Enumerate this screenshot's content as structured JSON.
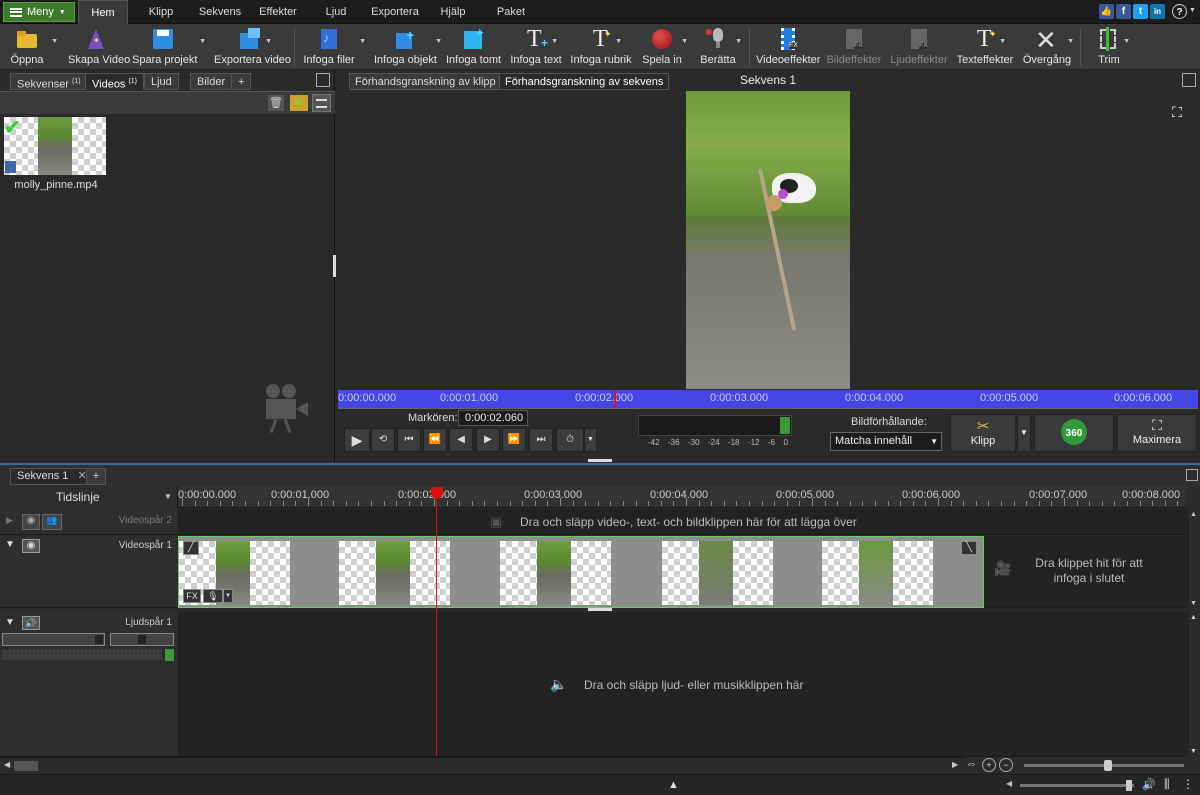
{
  "menubar": {
    "menu_label": "Meny",
    "tabs": [
      "Hem",
      "Klipp",
      "Sekvens",
      "Effekter",
      "Ljud",
      "Exportera",
      "Hjälp",
      "Paket"
    ],
    "social": [
      "f",
      "t",
      "in",
      "?"
    ]
  },
  "toolbar": {
    "open": "Öppna",
    "make_video": "Skapa Video",
    "save_project": "Spara projekt",
    "export_video": "Exportera video",
    "insert_files": "Infoga filer",
    "insert_object": "Infoga objekt",
    "insert_blank": "Infoga tomt",
    "insert_text": "Infoga text",
    "insert_title": "Infoga rubrik",
    "record": "Spela in",
    "narrate": "Berätta",
    "video_effects": "Videoeffekter",
    "image_effects": "Bildeffekter",
    "audio_effects": "Ljudeffekter",
    "text_effects": "Texteffekter",
    "transition": "Övergång",
    "trim": "Trim"
  },
  "leftpanel": {
    "tabs": [
      {
        "label": "Sekvenser",
        "count": "(1)"
      },
      {
        "label": "Videos",
        "count": "(1)"
      },
      {
        "label": "Ljud",
        "count": ""
      },
      {
        "label": "Bilder",
        "count": ""
      },
      {
        "label": "+",
        "count": ""
      }
    ],
    "media": [
      {
        "name": "molly_pinne.mp4"
      }
    ]
  },
  "preview": {
    "tab_clip": "Förhandsgranskning av klipp",
    "tab_sequence": "Förhandsgranskning av sekvens",
    "title": "Sekvens 1",
    "ruler": [
      "0:00:00.000",
      "0:00:01.000",
      "0:00:02.000",
      "0:00:03.000",
      "0:00:04.000",
      "0:00:05.000",
      "0:00:06.000"
    ],
    "cursor_label": "Markören:",
    "cursor_value": "0:00:02.060",
    "meter_scale": [
      "-42",
      "-36",
      "-30",
      "-24",
      "-18",
      "-12",
      "-6",
      "0"
    ],
    "aspect_label": "Bildförhållande:",
    "aspect_value": "Matcha innehåll",
    "clip_button": "Klipp",
    "btn_360": "360",
    "maximize": "Maximera"
  },
  "timeline": {
    "seq_tab": "Sekvens 1",
    "add_tab": "+",
    "mode": "Tidslinje",
    "ruler": [
      "0:00:00.000",
      "0:00:01.000",
      "0:00:02.000",
      "0:00:03.000",
      "0:00:04.000",
      "0:00:05.000",
      "0:00:06.000",
      "0:00:07.000",
      "0:00:08.000"
    ],
    "video_track_2": "Videospår 2",
    "video_track_2_hint": "Dra och släpp video-, text- och bildklippen här för att lägga över",
    "video_track_1": "Videospår 1",
    "video_track_1_end_hint": "Dra klippet hit för att infoga i slutet",
    "audio_track_1": "Ljudspår 1",
    "audio_hint": "Dra och släpp ljud- eller musikklippen här",
    "fx_label": "FX"
  },
  "colors": {
    "accent_green": "#3b7a2a",
    "ruler_blue": "#4545e8",
    "playhead": "#e01010"
  }
}
